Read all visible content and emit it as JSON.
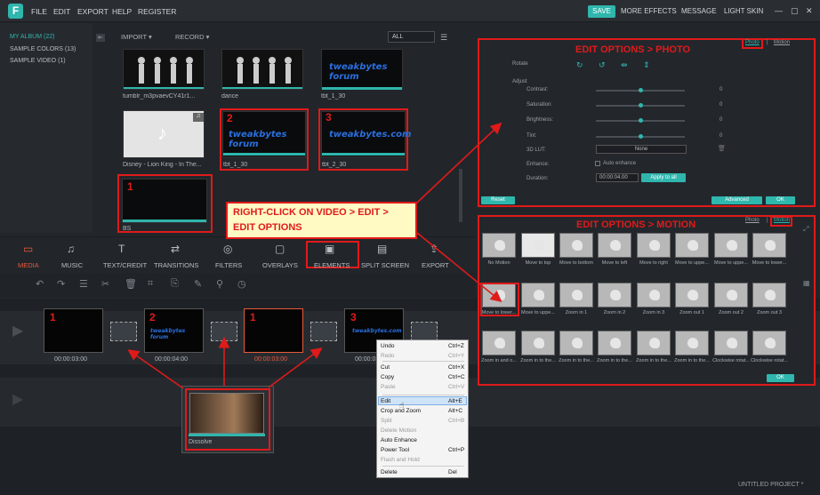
{
  "topbar": {
    "logo": "F",
    "menu": [
      "FILE",
      "EDIT",
      "EXPORT",
      "HELP",
      "REGISTER"
    ],
    "save": "SAVE",
    "right": [
      "MORE EFFECTS",
      "MESSAGE",
      "LIGHT SKIN"
    ],
    "window_controls": [
      "—",
      "▢",
      "✕"
    ]
  },
  "album": {
    "items": [
      "MY ALBUM (22)",
      "SAMPLE COLORS (13)",
      "SAMPLE VIDEO (1)"
    ],
    "collapse": "⇤"
  },
  "library": {
    "tabs": [
      "IMPORT ▾",
      "RECORD ▾"
    ],
    "filter": "ALL",
    "thumbs": [
      {
        "label": "tumblr_m3pvaevCY41r1...",
        "type": "dance"
      },
      {
        "label": "dance",
        "type": "dance"
      },
      {
        "label": "tbt_1_30",
        "type": "text",
        "text": "tweakbytes forum"
      },
      {
        "label": "Disney - Lion King - In The...",
        "type": "music"
      },
      {
        "label": "tbt_1_30",
        "type": "text",
        "text": "tweakbytes forum",
        "num": "2"
      },
      {
        "label": "tbt_2_30",
        "type": "text",
        "text": "tweakbytes.com",
        "num": "3"
      },
      {
        "label": "BS",
        "type": "black",
        "num": "1"
      }
    ]
  },
  "tabs": [
    "MEDIA",
    "MUSIC",
    "TEXT/CREDIT",
    "TRANSITIONS",
    "FILTERS",
    "OVERLAYS",
    "ELEMENTS",
    "SPLIT SCREEN",
    "EXPORT"
  ],
  "callout": {
    "line1": "RIGHT-CLICK ON VIDEO > EDIT >",
    "line2": "EDIT OPTIONS"
  },
  "photo_panel": {
    "title": "EDIT OPTIONS > PHOTO",
    "tab_photo": "Photo",
    "tab_sep": "|",
    "tab_motion": "Motion",
    "rotate": "Rotate",
    "adjust": "Adjust",
    "rows": [
      {
        "label": "Contrast:",
        "value": "0"
      },
      {
        "label": "Saturation:",
        "value": "0"
      },
      {
        "label": "Brightness:",
        "value": "0"
      },
      {
        "label": "Tint:",
        "value": "0"
      }
    ],
    "lut_label": "3D LUT:",
    "lut_value": "None",
    "enhance_label": "Enhance:",
    "enhance_check": "Auto enhance",
    "duration_label": "Duration:",
    "duration_value": "00:00:04.00",
    "apply": "Apply to all",
    "reset": "Reset",
    "advanced": "Advanced",
    "ok": "OK"
  },
  "motion_panel": {
    "title": "EDIT OPTIONS > MOTION",
    "tab_photo": "Photo",
    "tab_sep": "|",
    "tab_motion": "Motion",
    "items": [
      "No Motion",
      "Move to top",
      "Move to bottom",
      "Move to left",
      "Move to right",
      "Move to uppe...",
      "Move to uppe...",
      "Move to lower...",
      "Move to lower...",
      "Move to uppe...",
      "Zoom in 1",
      "Zoom in 2",
      "Zoom in 3",
      "Zoom out 1",
      "Zoom out 2",
      "Zoom out 3",
      "Zoom in and o...",
      "Zoom in to the...",
      "Zoom in to the...",
      "Zoom in to the...",
      "Zoom in to the...",
      "Zoom in to the...",
      "Clockwise rotat...",
      "Clockwise rotat..."
    ],
    "ok": "OK"
  },
  "timeline": {
    "clips": [
      {
        "num": "1",
        "time": "00:00:03:00"
      },
      {
        "num": "2",
        "time": "00:00:04:00",
        "text": "tweakbytes forum"
      },
      {
        "num": "1",
        "time": "00:00:03:00"
      },
      {
        "num": "3",
        "time": "00:00:03:00",
        "text": "tweakbytes.com"
      }
    ],
    "dissolve": "Dissolve",
    "project": "UNTITLED PROJECT *"
  },
  "context_menu": [
    {
      "label": "Undo",
      "shortcut": "Ctrl+Z",
      "disabled": false
    },
    {
      "label": "Redo",
      "shortcut": "Ctrl+Y",
      "disabled": true
    },
    {
      "label": "Cut",
      "shortcut": "Ctrl+X",
      "disabled": false
    },
    {
      "label": "Copy",
      "shortcut": "Ctrl+C",
      "disabled": false
    },
    {
      "label": "Paste",
      "shortcut": "Ctrl+V",
      "disabled": true
    },
    {
      "label": "Edit",
      "shortcut": "Alt+E",
      "disabled": false,
      "highlight": true
    },
    {
      "label": "Crop and Zoom",
      "shortcut": "Alt+C",
      "disabled": false
    },
    {
      "label": "Split",
      "shortcut": "Ctrl+B",
      "disabled": true
    },
    {
      "label": "Delete Motion",
      "shortcut": "",
      "disabled": true
    },
    {
      "label": "Auto Enhance",
      "shortcut": "",
      "disabled": false
    },
    {
      "label": "Power Tool",
      "shortcut": "Ctrl+P",
      "disabled": false
    },
    {
      "label": "Flash and Hold",
      "shortcut": "",
      "disabled": true
    },
    {
      "label": "Delete",
      "shortcut": "Del",
      "disabled": false
    }
  ],
  "colors": {
    "accent": "#2fb6ad",
    "annotation": "#e01a1a"
  }
}
